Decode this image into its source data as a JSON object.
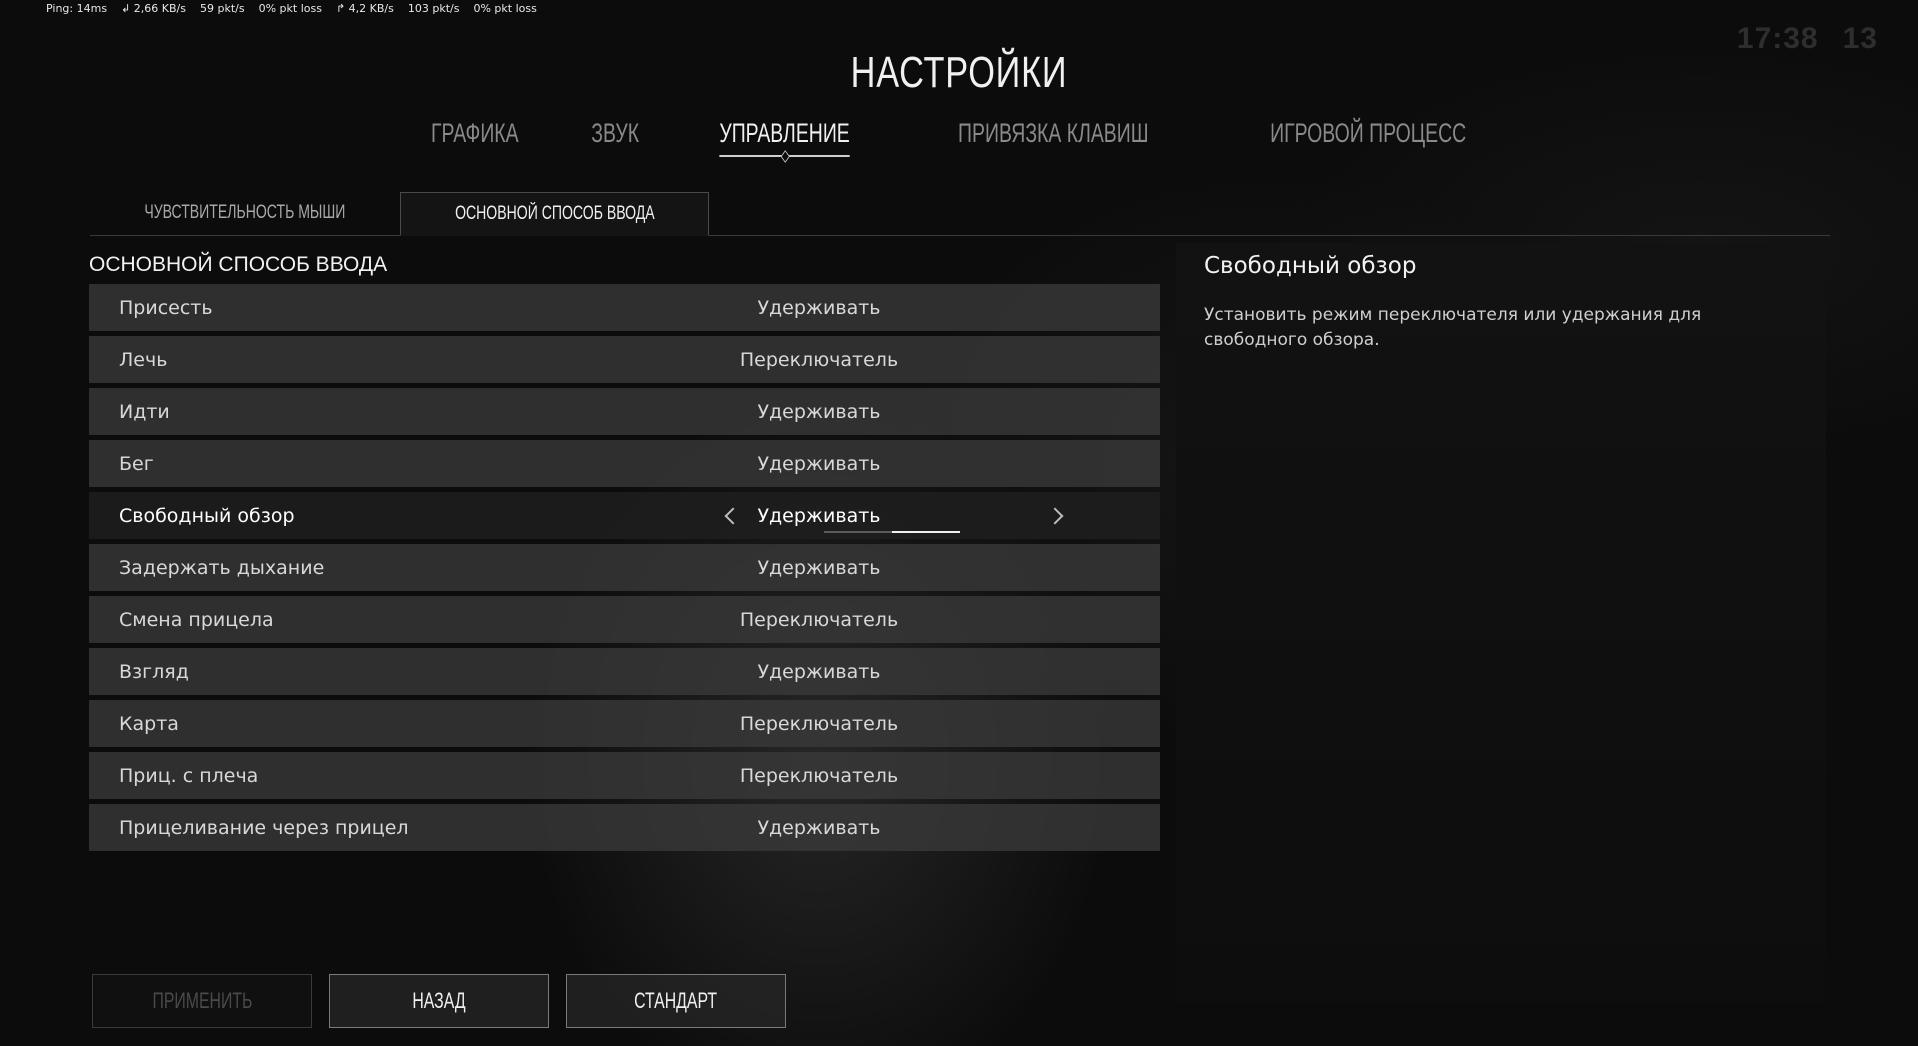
{
  "netstats": {
    "ping": "Ping: 14ms",
    "down_rate": "2,66 KB/s",
    "down_pkts": "59 pkt/s",
    "down_loss": "0% pkt loss",
    "up_rate": "4,2 KB/s",
    "up_pkts": "103 pkt/s",
    "up_loss": "0% pkt loss"
  },
  "hud": {
    "time": "17:38",
    "count": "13"
  },
  "title": "НАСТРОЙКИ",
  "main_tabs": [
    {
      "label": "ГРАФИКА"
    },
    {
      "label": "ЗВУК"
    },
    {
      "label": "УПРАВЛЕНИЕ",
      "active": true
    },
    {
      "label": "ПРИВЯЗКА КЛАВИШ"
    },
    {
      "label": "ИГРОВОЙ ПРОЦЕСС"
    }
  ],
  "sub_tabs": [
    {
      "label": "ЧУВСТВИТЕЛЬНОСТЬ МЫШИ"
    },
    {
      "label": "ОСНОВНОЙ СПОСОБ ВВОДА",
      "active": true
    }
  ],
  "section_heading": "ОСНОВНОЙ СПОСОБ ВВОДА",
  "settings": [
    {
      "label": "Присесть",
      "value": "Удерживать"
    },
    {
      "label": "Лечь",
      "value": "Переключатель"
    },
    {
      "label": "Идти",
      "value": "Удерживать"
    },
    {
      "label": "Бег",
      "value": "Удерживать"
    },
    {
      "label": "Свободный обзор",
      "value": "Удерживать",
      "selected": true,
      "option_index": 2,
      "option_count": 2
    },
    {
      "label": "Задержать дыхание",
      "value": "Удерживать"
    },
    {
      "label": "Смена прицела",
      "value": "Переключатель"
    },
    {
      "label": "Взгляд",
      "value": "Удерживать"
    },
    {
      "label": "Карта",
      "value": "Переключатель"
    },
    {
      "label": "Приц. с плеча",
      "value": "Переключатель"
    },
    {
      "label": "Прицеливание через прицел",
      "value": "Удерживать"
    }
  ],
  "description": {
    "title": "Свободный обзор",
    "text": "Установить режим переключателя или удержания для свободного обзора."
  },
  "buttons": {
    "apply": "ПРИМЕНИТЬ",
    "back": "НАЗАД",
    "default": "СТАНДАРТ"
  },
  "icons": {
    "download": "download-arrow-icon",
    "upload": "upload-arrow-icon",
    "prev": "chevron-left-icon",
    "next": "chevron-right-icon"
  }
}
